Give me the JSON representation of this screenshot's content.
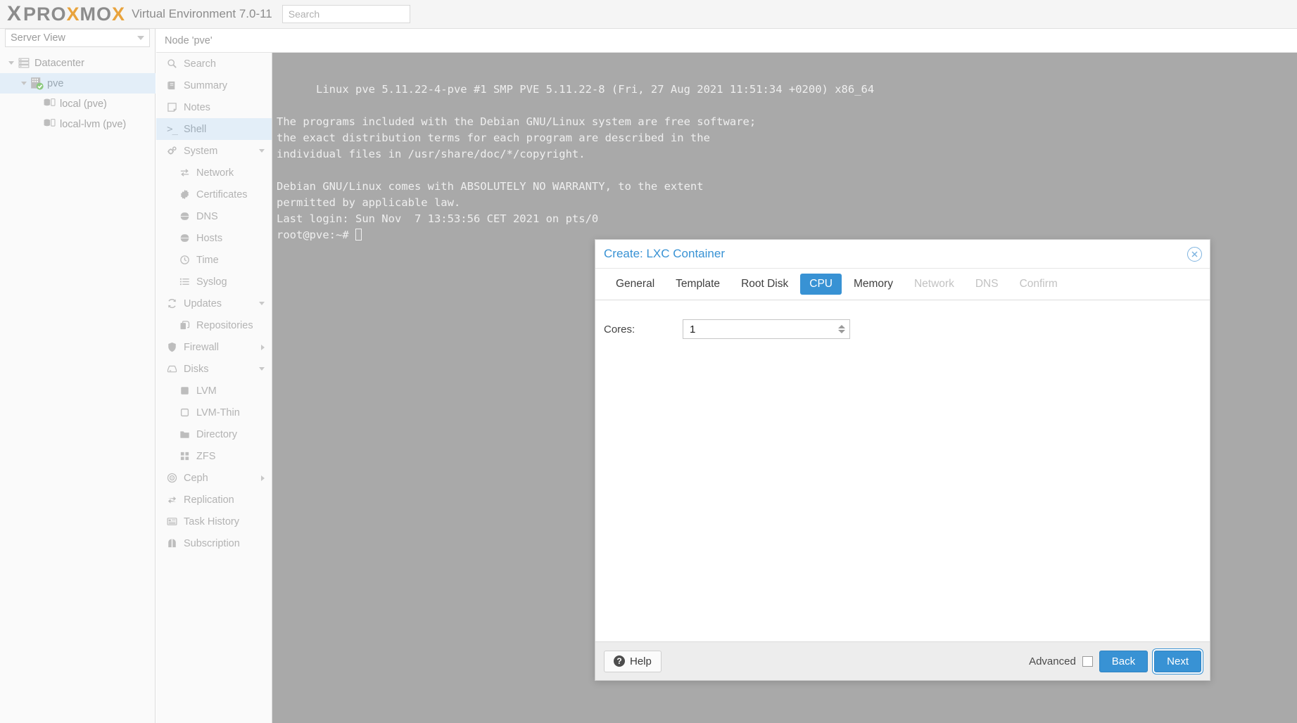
{
  "header": {
    "brand": {
      "x1": "X",
      "pro": "PRO",
      "x2": "X",
      "mo": "MO",
      "x3": "X"
    },
    "product": "Virtual Environment 7.0-11",
    "search_placeholder": "Search",
    "search_value": ""
  },
  "left_panel": {
    "view_selector": "Server View",
    "tree": [
      {
        "label": "Datacenter",
        "icon": "datacenter-icon",
        "depth": 0,
        "expander": "down",
        "selected": false
      },
      {
        "label": "pve",
        "icon": "node-icon",
        "depth": 1,
        "expander": "down",
        "selected": true
      },
      {
        "label": "local (pve)",
        "icon": "storage-icon",
        "depth": 2,
        "expander": "none",
        "selected": false
      },
      {
        "label": "local-lvm (pve)",
        "icon": "storage-icon",
        "depth": 2,
        "expander": "none",
        "selected": false
      }
    ]
  },
  "nav_header": "Node 'pve'",
  "nav_items": [
    {
      "label": "Search",
      "icon": "search-icon",
      "sub": false,
      "selected": false,
      "arrow": "none"
    },
    {
      "label": "Summary",
      "icon": "summary-icon",
      "sub": false,
      "selected": false,
      "arrow": "none"
    },
    {
      "label": "Notes",
      "icon": "notes-icon",
      "sub": false,
      "selected": false,
      "arrow": "none"
    },
    {
      "label": "Shell",
      "icon": "shell-icon",
      "sub": false,
      "selected": true,
      "arrow": "none"
    },
    {
      "label": "System",
      "icon": "system-icon",
      "sub": false,
      "selected": false,
      "arrow": "down"
    },
    {
      "label": "Network",
      "icon": "network-icon",
      "sub": true,
      "selected": false,
      "arrow": "none"
    },
    {
      "label": "Certificates",
      "icon": "certificate-icon",
      "sub": true,
      "selected": false,
      "arrow": "none"
    },
    {
      "label": "DNS",
      "icon": "globe-icon",
      "sub": true,
      "selected": false,
      "arrow": "none"
    },
    {
      "label": "Hosts",
      "icon": "globe-icon",
      "sub": true,
      "selected": false,
      "arrow": "none"
    },
    {
      "label": "Time",
      "icon": "clock-icon",
      "sub": true,
      "selected": false,
      "arrow": "none"
    },
    {
      "label": "Syslog",
      "icon": "list-icon",
      "sub": true,
      "selected": false,
      "arrow": "none"
    },
    {
      "label": "Updates",
      "icon": "refresh-icon",
      "sub": false,
      "selected": false,
      "arrow": "down"
    },
    {
      "label": "Repositories",
      "icon": "copy-icon",
      "sub": true,
      "selected": false,
      "arrow": "none"
    },
    {
      "label": "Firewall",
      "icon": "shield-icon",
      "sub": false,
      "selected": false,
      "arrow": "right"
    },
    {
      "label": "Disks",
      "icon": "disk-icon",
      "sub": false,
      "selected": false,
      "arrow": "down"
    },
    {
      "label": "LVM",
      "icon": "lvm-icon",
      "sub": true,
      "selected": false,
      "arrow": "none"
    },
    {
      "label": "LVM-Thin",
      "icon": "lvm-thin-icon",
      "sub": true,
      "selected": false,
      "arrow": "none"
    },
    {
      "label": "Directory",
      "icon": "folder-icon",
      "sub": true,
      "selected": false,
      "arrow": "none"
    },
    {
      "label": "ZFS",
      "icon": "zfs-icon",
      "sub": true,
      "selected": false,
      "arrow": "none"
    },
    {
      "label": "Ceph",
      "icon": "ceph-icon",
      "sub": false,
      "selected": false,
      "arrow": "right"
    },
    {
      "label": "Replication",
      "icon": "replication-icon",
      "sub": false,
      "selected": false,
      "arrow": "none"
    },
    {
      "label": "Task History",
      "icon": "task-history-icon",
      "sub": false,
      "selected": false,
      "arrow": "none"
    },
    {
      "label": "Subscription",
      "icon": "subscription-icon",
      "sub": false,
      "selected": false,
      "arrow": "none"
    }
  ],
  "terminal": {
    "lines": [
      "Linux pve 5.11.22-4-pve #1 SMP PVE 5.11.22-8 (Fri, 27 Aug 2021 11:51:34 +0200) x86_64",
      "",
      "The programs included with the Debian GNU/Linux system are free software;",
      "the exact distribution terms for each program are described in the",
      "individual files in /usr/share/doc/*/copyright.",
      "",
      "Debian GNU/Linux comes with ABSOLUTELY NO WARRANTY, to the extent",
      "permitted by applicable law.",
      "Last login: Sun Nov  7 13:53:56 CET 2021 on pts/0"
    ],
    "prompt": "root@pve:~# "
  },
  "dialog": {
    "title": "Create: LXC Container",
    "close_icon": "close-icon",
    "tabs": [
      {
        "label": "General",
        "state": "normal"
      },
      {
        "label": "Template",
        "state": "normal"
      },
      {
        "label": "Root Disk",
        "state": "normal"
      },
      {
        "label": "CPU",
        "state": "active"
      },
      {
        "label": "Memory",
        "state": "normal"
      },
      {
        "label": "Network",
        "state": "disabled"
      },
      {
        "label": "DNS",
        "state": "disabled"
      },
      {
        "label": "Confirm",
        "state": "disabled"
      }
    ],
    "fields": [
      {
        "label": "Cores:",
        "value": "1"
      }
    ],
    "footer": {
      "help_label": "Help",
      "advanced_label": "Advanced",
      "advanced_checked": false,
      "back_label": "Back",
      "next_label": "Next"
    }
  },
  "colors": {
    "accent_blue": "#3892d4",
    "brand_orange": "#e8a33d",
    "brand_grey": "#8c8c8c",
    "selection_blue": "#e3eef8",
    "terminal_bg": "#a9a9a9"
  }
}
